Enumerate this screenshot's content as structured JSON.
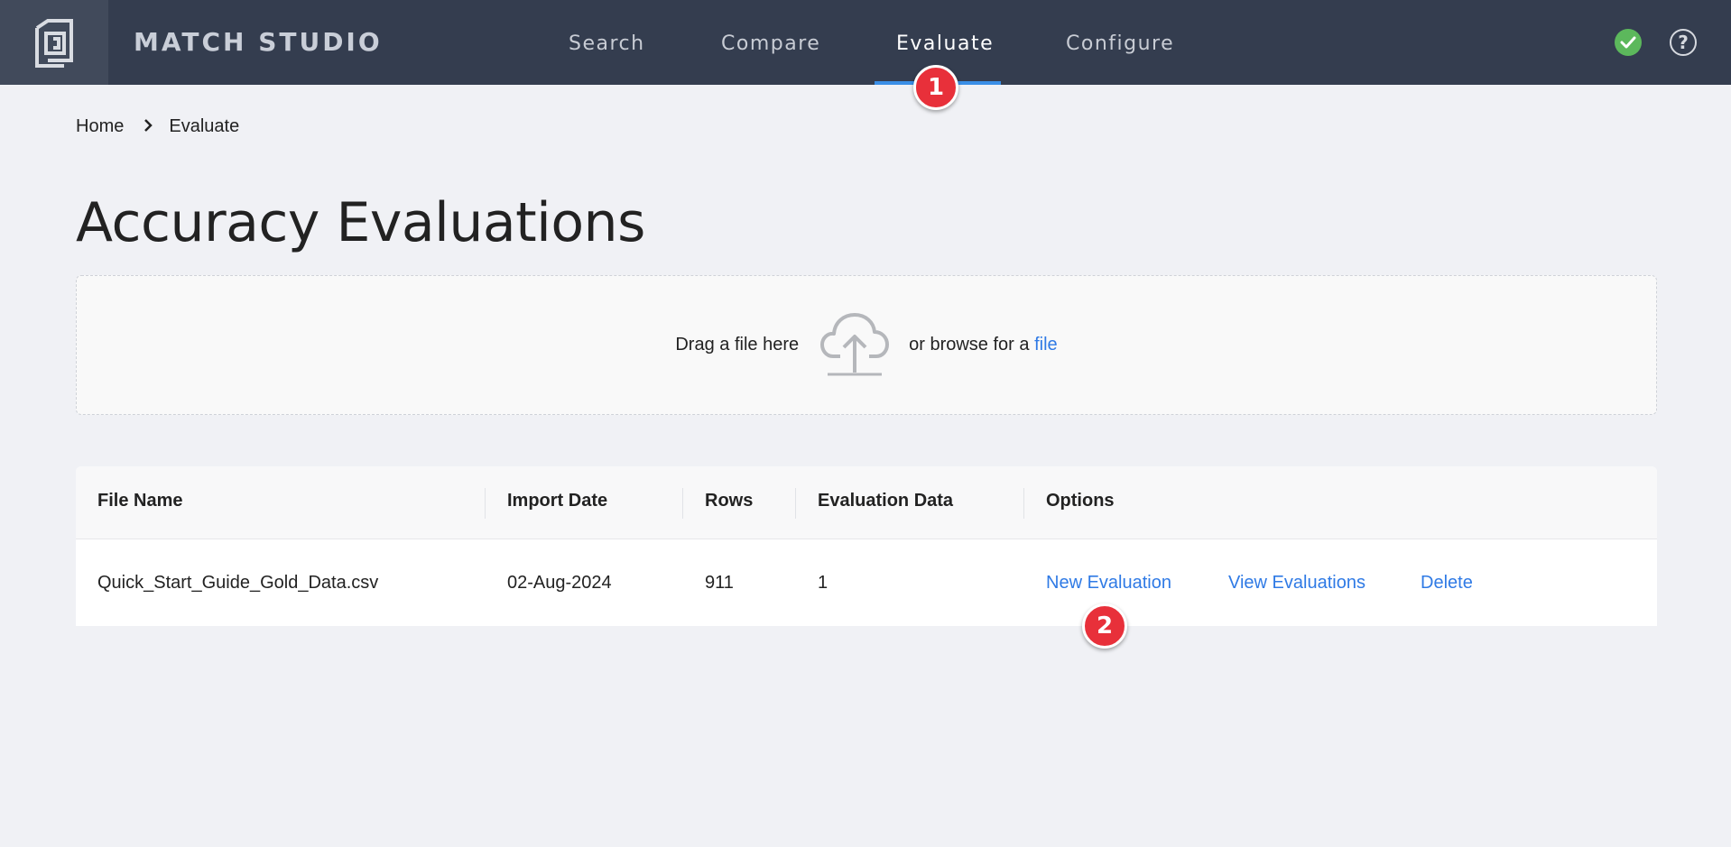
{
  "app": {
    "brand": "MATCH STUDIO"
  },
  "nav": {
    "items": [
      {
        "label": "Search"
      },
      {
        "label": "Compare"
      },
      {
        "label": "Evaluate",
        "active": true
      },
      {
        "label": "Configure"
      }
    ]
  },
  "status_icons": [
    "check-circle-icon",
    "help-icon"
  ],
  "help_glyph": "?",
  "annotations": {
    "badge_1": "1",
    "badge_2": "2"
  },
  "breadcrumb": {
    "home": "Home",
    "current": "Evaluate"
  },
  "page_title": "Accuracy Evaluations",
  "upload": {
    "drag_text": "Drag a file here",
    "browse_text": "or browse for a",
    "browse_link": "file"
  },
  "table": {
    "columns": [
      "File Name",
      "Import Date",
      "Rows",
      "Evaluation Data",
      "Options"
    ],
    "rows": [
      {
        "file_name": "Quick_Start_Guide_Gold_Data.csv",
        "import_date": "02-Aug-2024",
        "rows": "911",
        "evaluation_data": "1",
        "options": [
          "New Evaluation",
          "View Evaluations",
          "Delete"
        ]
      }
    ]
  },
  "colors": {
    "topbar": "#343d4f",
    "accent": "#3a8ee6",
    "link": "#2f7ae5",
    "status_ok": "#5cb85c",
    "badge": "#e8303a"
  }
}
